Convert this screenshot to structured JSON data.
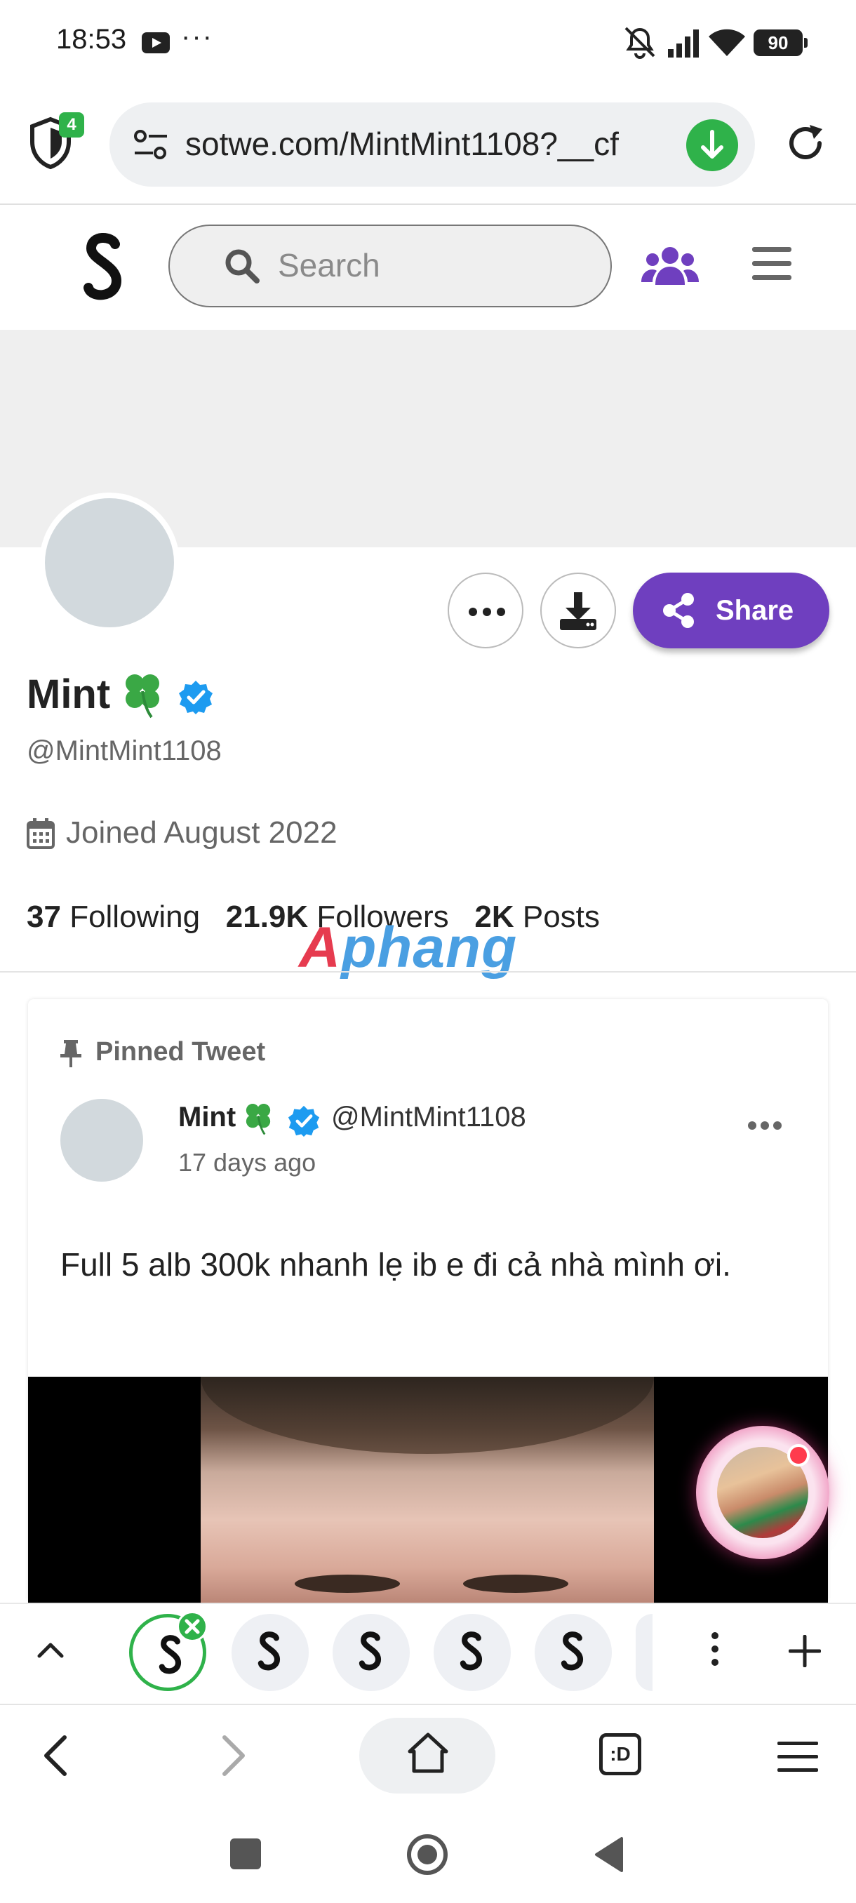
{
  "status_bar": {
    "time": "18:53",
    "more_indicator": "···",
    "battery": "90",
    "icons": [
      "youtube-icon",
      "mute-icon",
      "signal-icon",
      "wifi-icon",
      "battery-icon"
    ]
  },
  "browser": {
    "shield_badge": "4",
    "url": "sotwe.com/MintMint1108?__cf",
    "open_tabs_icon_label": ":D"
  },
  "site_header": {
    "logo": "S",
    "search_placeholder": "Search"
  },
  "profile": {
    "name": "Mint",
    "handle": "@MintMint1108",
    "joined": "Joined August 2022",
    "following_count": "37",
    "following_label": "Following",
    "followers_count": "21.9K",
    "followers_label": "Followers",
    "posts_count": "2K",
    "posts_label": "Posts",
    "share_label": "Share"
  },
  "watermark": {
    "part1": "A",
    "part2": "phang"
  },
  "pinned_tweet": {
    "label": "Pinned Tweet",
    "author_name": "Mint",
    "author_handle": "@MintMint1108",
    "time": "17 days ago",
    "text": "Full 5 alb 300k nhanh lẹ ib e đi cả nhà mình ơi."
  },
  "colors": {
    "brand_purple": "#6f3fbf",
    "verified_blue": "#1d9bf0",
    "green_accent": "#2fb24a",
    "clover_green": "#3aa845"
  }
}
